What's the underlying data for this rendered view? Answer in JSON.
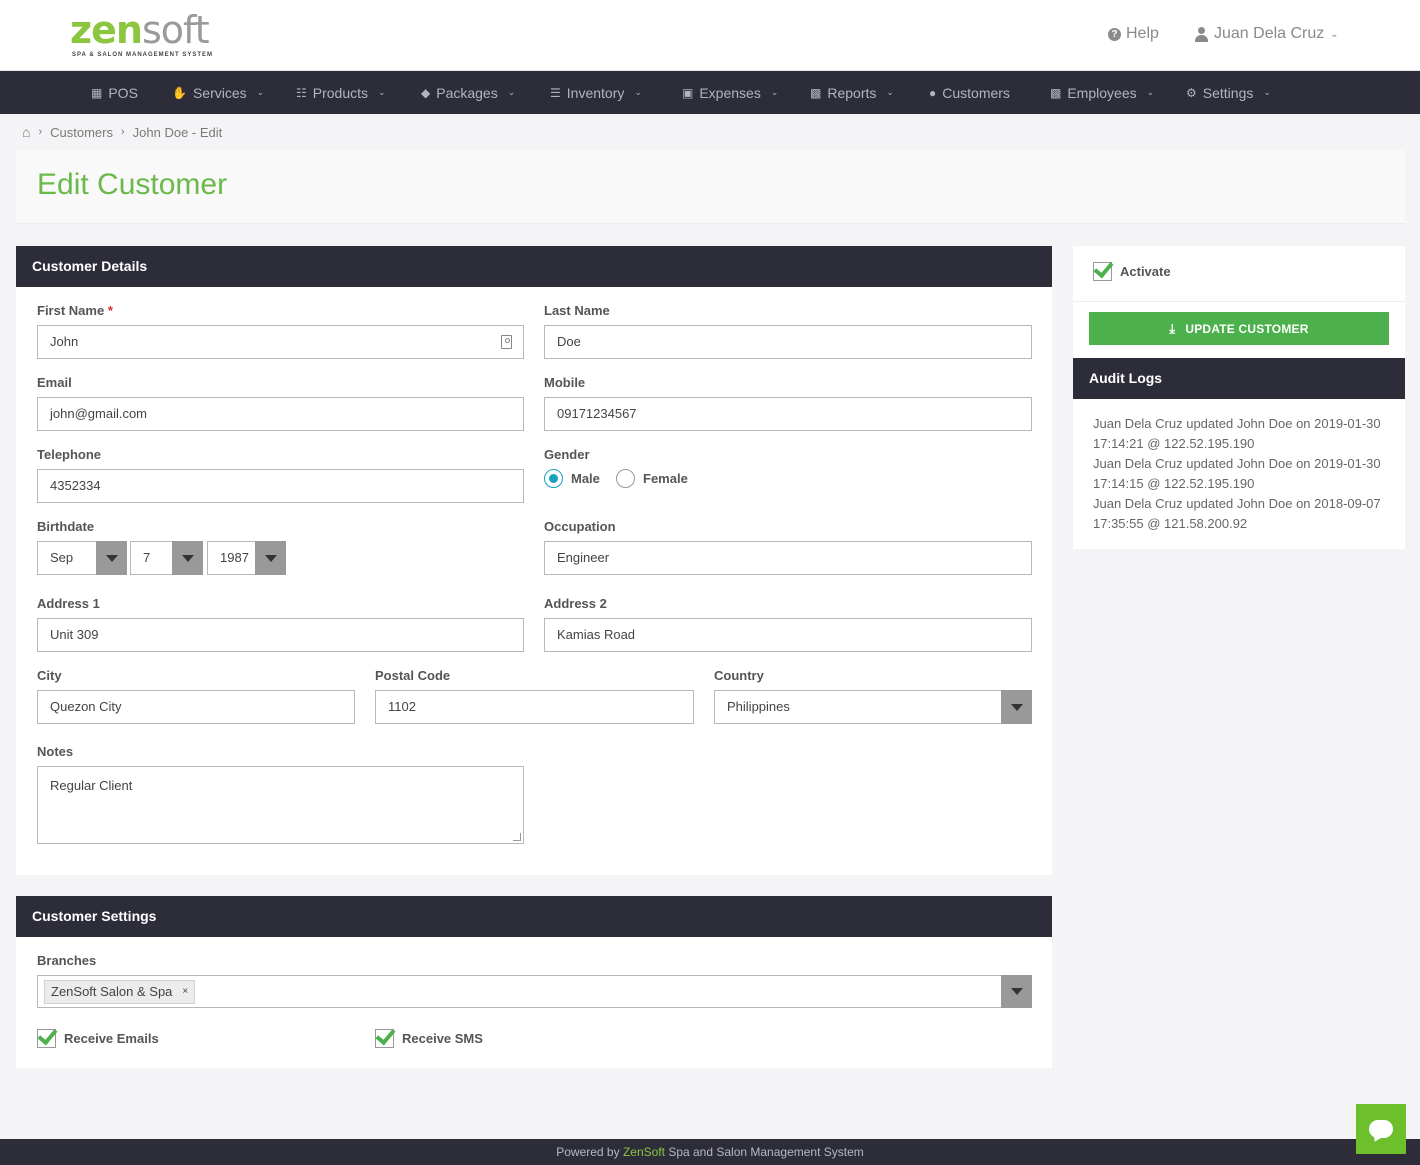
{
  "header": {
    "logo_main": "zen",
    "logo_secondary": "soft",
    "logo_tagline": "SPA & SALON MANAGEMENT SYSTEM",
    "help_label": "Help",
    "user_name": "Juan Dela Cruz"
  },
  "nav": {
    "items": [
      {
        "label": "POS",
        "icon": "register-icon"
      },
      {
        "label": "Services",
        "icon": "hand-icon"
      },
      {
        "label": "Products",
        "icon": "cart-icon"
      },
      {
        "label": "Packages",
        "icon": "tags-icon"
      },
      {
        "label": "Inventory",
        "icon": "list-icon"
      },
      {
        "label": "Expenses",
        "icon": "picture-icon"
      },
      {
        "label": "Reports",
        "icon": "bar-chart-icon"
      },
      {
        "label": "Customers",
        "icon": "users-icon"
      },
      {
        "label": "Employees",
        "icon": "briefcase-icon"
      },
      {
        "label": "Settings",
        "icon": "gear-icon"
      }
    ]
  },
  "breadcrumb": {
    "items": [
      "Customers",
      "John Doe - Edit"
    ]
  },
  "page": {
    "title": "Edit Customer"
  },
  "customer_details": {
    "heading": "Customer Details",
    "first_name_label": "First Name",
    "first_name_value": "John",
    "last_name_label": "Last Name",
    "last_name_value": "Doe",
    "email_label": "Email",
    "email_value": "john@gmail.com",
    "mobile_label": "Mobile",
    "mobile_value": "09171234567",
    "telephone_label": "Telephone",
    "telephone_value": "4352334",
    "gender_label": "Gender",
    "gender_male": "Male",
    "gender_female": "Female",
    "gender_selected": "Male",
    "birthdate_label": "Birthdate",
    "birth_month": "Sep",
    "birth_day": "7",
    "birth_year": "1987",
    "occupation_label": "Occupation",
    "occupation_value": "Engineer",
    "address1_label": "Address 1",
    "address1_value": "Unit 309",
    "address2_label": "Address 2",
    "address2_value": "Kamias Road",
    "city_label": "City",
    "city_value": "Quezon City",
    "postal_label": "Postal Code",
    "postal_value": "1102",
    "country_label": "Country",
    "country_value": "Philippines",
    "notes_label": "Notes",
    "notes_value": "Regular Client"
  },
  "customer_settings": {
    "heading": "Customer Settings",
    "branches_label": "Branches",
    "branches_selected": [
      "ZenSoft Salon & Spa"
    ],
    "receive_emails_label": "Receive Emails",
    "receive_emails": true,
    "receive_sms_label": "Receive SMS",
    "receive_sms": true
  },
  "sidebar": {
    "activate_label": "Activate",
    "activate_checked": true,
    "update_button": "UPDATE CUSTOMER",
    "audit_heading": "Audit Logs",
    "audit_logs": [
      "Juan Dela Cruz updated John Doe on 2019-01-30 17:14:21 @ 122.52.195.190",
      "Juan Dela Cruz updated John Doe on 2019-01-30 17:14:15 @ 122.52.195.190",
      "Juan Dela Cruz updated John Doe on 2018-09-07 17:35:55 @ 121.58.200.92"
    ]
  },
  "footer": {
    "prefix": "Powered by",
    "brand": "ZenSoft",
    "suffix": "Spa and Salon Management System"
  },
  "colors": {
    "brand_green": "#6ab94a",
    "nav_dark": "#2d2d3a",
    "button_green": "#4cb04c",
    "radio_teal": "#16a2b8"
  }
}
